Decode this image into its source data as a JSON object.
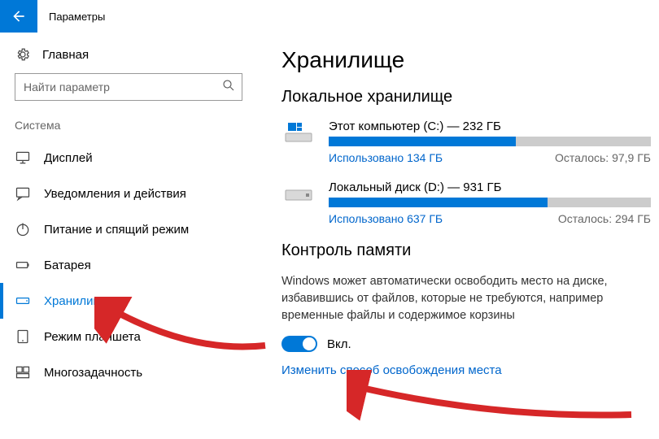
{
  "header": {
    "title": "Параметры"
  },
  "sidebar": {
    "home_label": "Главная",
    "search_placeholder": "Найти параметр",
    "section_title": "Система",
    "items": [
      {
        "label": "Дисплей"
      },
      {
        "label": "Уведомления и действия"
      },
      {
        "label": "Питание и спящий режим"
      },
      {
        "label": "Батарея"
      },
      {
        "label": "Хранилище"
      },
      {
        "label": "Режим планшета"
      },
      {
        "label": "Многозадачность"
      }
    ]
  },
  "main": {
    "title": "Хранилище",
    "local_storage_title": "Локальное хранилище",
    "drives": [
      {
        "name": "Этот компьютер (C:) — 232 ГБ",
        "used": "Использовано 134 ГБ",
        "free": "Осталось: 97,9 ГБ",
        "fill": 58
      },
      {
        "name": "Локальный диск (D:) — 931 ГБ",
        "used": "Использовано 637 ГБ",
        "free": "Осталось: 294 ГБ",
        "fill": 68
      }
    ],
    "sense_title": "Контроль памяти",
    "sense_desc": "Windows может автоматически освободить место на диске, избавившись от файлов, которые не требуются, например временные файлы и содержимое корзины",
    "toggle_label": "Вкл.",
    "link": "Изменить способ освобождения места"
  }
}
